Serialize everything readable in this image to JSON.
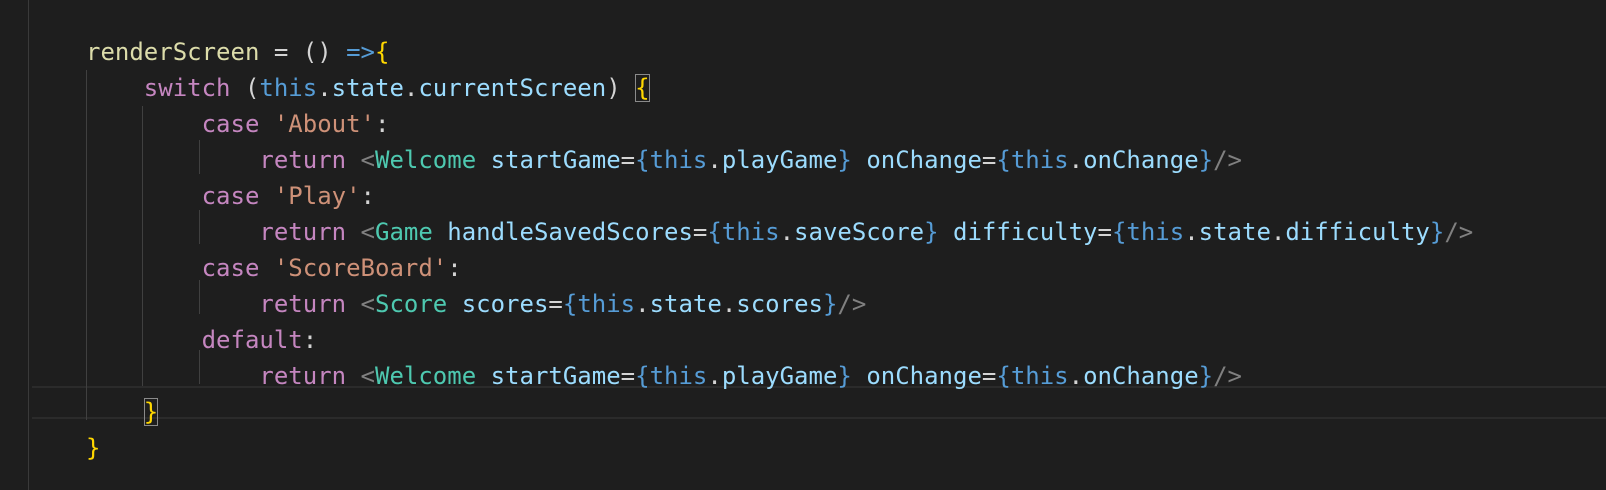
{
  "editor": {
    "lines": {
      "l1": {
        "fn": "renderScreen",
        "t1": " = () ",
        "arrow": "=>",
        "brace": "{"
      },
      "l2": {
        "kw": "switch",
        "t1": " (",
        "this": "this",
        "dot1": ".",
        "p1": "state",
        "dot2": ".",
        "p2": "currentScreen",
        "t2": ") ",
        "brace": "{"
      },
      "l3": {
        "kw": "case",
        "sp": " ",
        "str": "'About'",
        "colon": ":"
      },
      "l4": {
        "kw": "return",
        "sp": " ",
        "lt": "<",
        "comp": "Welcome",
        "sp2": " ",
        "a1": "startGame",
        "eq1": "=",
        "ob1": "{",
        "this1": "this",
        "dot1": ".",
        "v1": "playGame",
        "cb1": "}",
        "sp3": " ",
        "a2": "onChange",
        "eq2": "=",
        "ob2": "{",
        "this2": "this",
        "dot2": ".",
        "v2": "onChange",
        "cb2": "}",
        "end": "/>"
      },
      "l5": {
        "kw": "case",
        "sp": " ",
        "str": "'Play'",
        "colon": ":"
      },
      "l6": {
        "kw": "return",
        "sp": " ",
        "lt": "<",
        "comp": "Game",
        "sp2": " ",
        "a1": "handleSavedScores",
        "eq1": "=",
        "ob1": "{",
        "this1": "this",
        "dot1": ".",
        "v1": "saveScore",
        "cb1": "}",
        "sp3": " ",
        "a2": "difficulty",
        "eq2": "=",
        "ob2": "{",
        "this2": "this",
        "dot2": ".",
        "v2a": "state",
        "dot3": ".",
        "v2b": "difficulty",
        "cb2": "}",
        "end": "/>"
      },
      "l7": {
        "kw": "case",
        "sp": " ",
        "str": "'ScoreBoard'",
        "colon": ":"
      },
      "l8": {
        "kw": "return",
        "sp": " ",
        "lt": "<",
        "comp": "Score",
        "sp2": " ",
        "a1": "scores",
        "eq1": "=",
        "ob1": "{",
        "this1": "this",
        "dot1": ".",
        "v1a": "state",
        "dot2": ".",
        "v1b": "scores",
        "cb1": "}",
        "end": "/>"
      },
      "l9": {
        "kw": "default",
        "colon": ":"
      },
      "l10": {
        "kw": "return",
        "sp": " ",
        "lt": "<",
        "comp": "Welcome",
        "sp2": " ",
        "a1": "startGame",
        "eq1": "=",
        "ob1": "{",
        "this1": "this",
        "dot1": ".",
        "v1": "playGame",
        "cb1": "}",
        "sp3": " ",
        "a2": "onChange",
        "eq2": "=",
        "ob2": "{",
        "this2": "this",
        "dot2": ".",
        "v2": "onChange",
        "cb2": "}",
        "end": "/>"
      },
      "l11": {
        "brace": "}"
      },
      "l12": {
        "brace": "}"
      }
    }
  }
}
